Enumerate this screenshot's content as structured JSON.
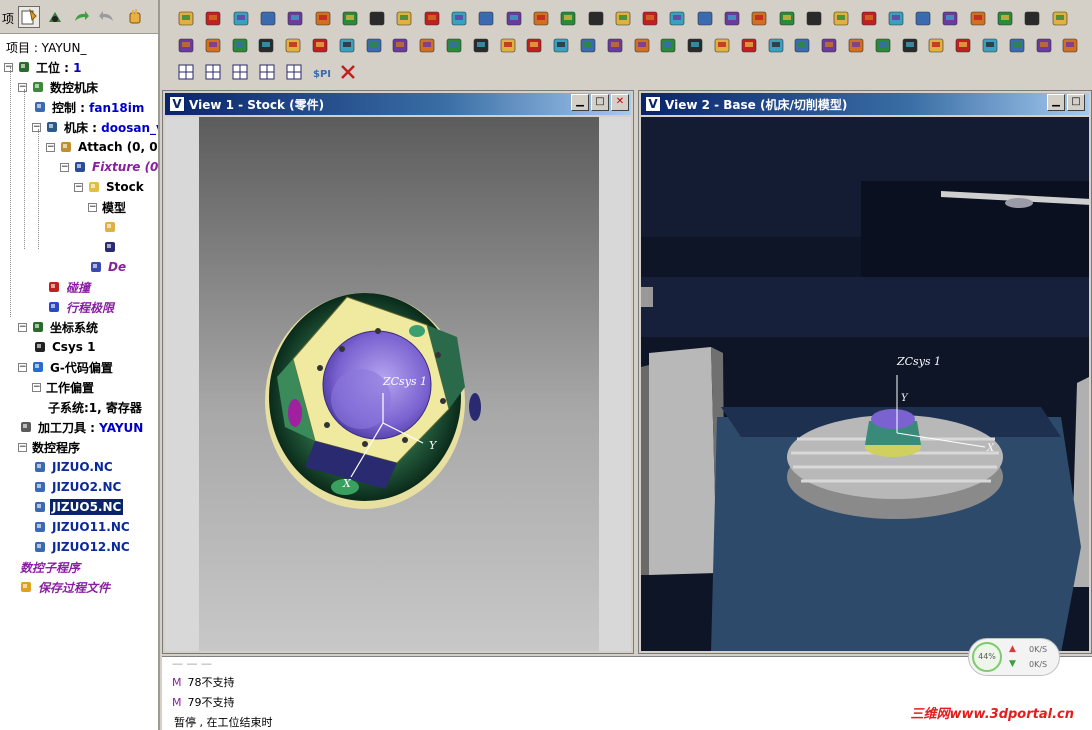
{
  "left_panel": {
    "tab_label": "项",
    "tree": [
      {
        "text": "项目 : YAYUN_",
        "indent": 0,
        "style": "plain"
      },
      {
        "text": "工位 : ",
        "value": "1",
        "indent": 0,
        "style": "bold",
        "icon": "setup-icon"
      },
      {
        "text": "数控机床",
        "indent": 1,
        "style": "bold",
        "icon": "machine-icon"
      },
      {
        "text": "控制 : ",
        "value": "fan18im",
        "indent": 2,
        "style": "bold",
        "icon": "control-icon"
      },
      {
        "text": "机床 : ",
        "value": "doosan_v",
        "indent": 2,
        "style": "bold",
        "icon": "machine-tool-icon"
      },
      {
        "text": "Attach (0, 0,",
        "indent": 3,
        "style": "bold",
        "icon": "attach-icon"
      },
      {
        "text": "Fixture (0",
        "indent": 4,
        "style": "purple",
        "icon": "fixture-icon"
      },
      {
        "text": "Stock",
        "indent": 5,
        "style": "bold",
        "icon": "stock-icon"
      },
      {
        "text": "模型",
        "indent": 6,
        "style": "bold"
      },
      {
        "text": "",
        "indent": 7,
        "style": "plain",
        "icon": "model-file-icon"
      },
      {
        "text": "",
        "indent": 7,
        "style": "plain",
        "icon": "model-solid-icon"
      },
      {
        "text": "De",
        "indent": 6,
        "style": "purple",
        "icon": "design-icon"
      },
      {
        "text": "碰撞",
        "indent": 3,
        "style": "purple",
        "icon": "collision-icon"
      },
      {
        "text": "行程极限",
        "indent": 3,
        "style": "purple",
        "icon": "travel-limit-icon"
      },
      {
        "text": "坐标系统",
        "indent": 1,
        "style": "bold",
        "icon": "coordinate-icon"
      },
      {
        "text": "Csys 1",
        "indent": 2,
        "style": "bold",
        "icon": "csys-icon"
      },
      {
        "text": "G-代码偏置",
        "indent": 1,
        "style": "bold",
        "icon": "gcode-offset-icon"
      },
      {
        "text": "工作偏置",
        "indent": 2,
        "style": "bold"
      },
      {
        "text": "子系统:1, 寄存器",
        "indent": 3,
        "style": "bold"
      },
      {
        "text": "加工刀具 : ",
        "value": "YAYUN",
        "indent": 1,
        "style": "bold",
        "icon": "tool-icon"
      },
      {
        "text": "数控程序",
        "indent": 1,
        "style": "bold"
      },
      {
        "text": "JIZUO.NC",
        "indent": 2,
        "style": "blue",
        "icon": "nc-file-icon"
      },
      {
        "text": "JIZUO2.NC",
        "indent": 2,
        "style": "blue",
        "icon": "nc-file-icon"
      },
      {
        "text": "JIZUO5.NC",
        "indent": 2,
        "style": "sel",
        "icon": "nc-file-icon"
      },
      {
        "text": "JIZUO11.NC",
        "indent": 2,
        "style": "blue",
        "icon": "nc-file-icon"
      },
      {
        "text": "JIZUO12.NC",
        "indent": 2,
        "style": "blue",
        "icon": "nc-file-icon"
      },
      {
        "text": "数控子程序",
        "indent": 1,
        "style": "purple"
      },
      {
        "text": "保存过程文件",
        "indent": 1,
        "style": "purple",
        "icon": "save-process-icon"
      }
    ]
  },
  "views": {
    "view1": {
      "title": "View 1 - Stock (零件)",
      "csys_label": "ZCsys 1",
      "axis_y": "Y",
      "axis_x": "X"
    },
    "view2": {
      "title": "View 2 - Base (机床/切削模型)",
      "csys_label": "ZCsys 1",
      "axis_y": "Y",
      "axis_x": "X"
    }
  },
  "console": {
    "lines": [
      {
        "prefix": "M",
        "text": "78不支持"
      },
      {
        "prefix": "M",
        "text": "79不支持"
      },
      {
        "prefix": "",
        "text": "暂停 , 在工位结束时"
      }
    ],
    "watermark": "三维网www.3dportal.cn"
  },
  "net_widget": {
    "percent": "44%",
    "up": "0K/S",
    "down": "0K/S"
  },
  "colors": {
    "title_bar": "#0a246a",
    "selection": "#0a246a",
    "accent_purple": "#8a1ea0"
  }
}
